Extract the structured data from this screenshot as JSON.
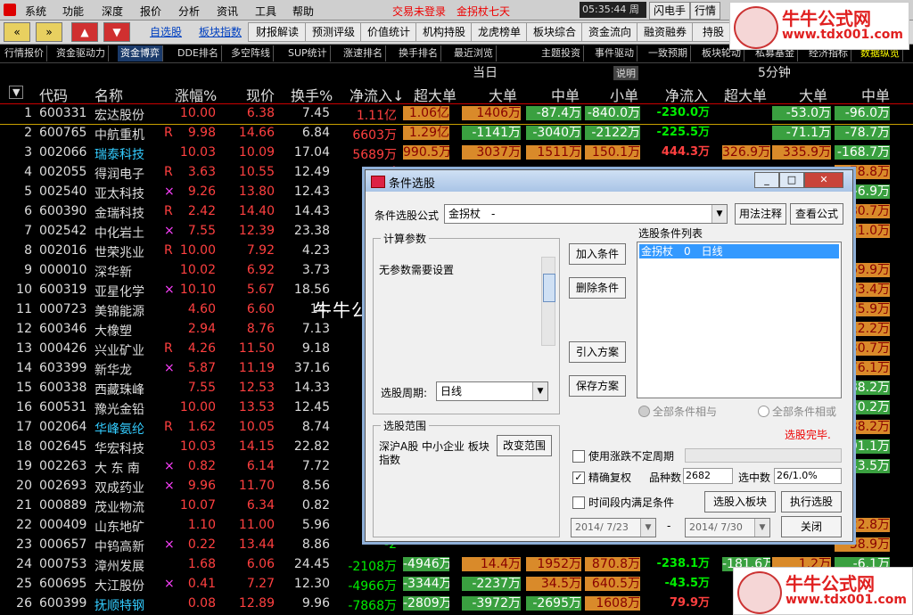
{
  "menu": {
    "items": [
      "系统",
      "功能",
      "深度",
      "报价",
      "分析",
      "资讯",
      "工具",
      "帮助"
    ],
    "status_warning": "交易未登录",
    "formula_title": "金拐杖七天",
    "clock": "05:35:44 周三",
    "right_buttons": [
      "闪电手",
      "行情"
    ]
  },
  "toolbar": {
    "arrows": [
      "«",
      "»",
      "▲",
      "▼"
    ],
    "links": [
      "自选股",
      "板块指数"
    ],
    "buttons": [
      "财报解读",
      "预测评级",
      "价值统计",
      "机构持股",
      "龙虎榜单",
      "板块综合",
      "资金流向",
      "融资融券",
      "持股"
    ]
  },
  "tabs": [
    "行情报价",
    "资金驱动力",
    "资金博弈",
    "DDE排名",
    "多空阵线",
    "SUP统计",
    "涨速排名",
    "换手排名",
    "最近浏览",
    "主题投资",
    "事件驱动",
    "一致预期",
    "板块轮动",
    "私募基金",
    "经济指标",
    "数据纵览"
  ],
  "header_top": {
    "today": "当日",
    "explain": "说明",
    "min5": "5分钟"
  },
  "columns": [
    "代码",
    "名称",
    "涨幅%",
    "现价",
    "换手%",
    "净流入↓",
    "超大单",
    "大单",
    "中单",
    "小单",
    "净流入",
    "超大单",
    "大单",
    "中单"
  ],
  "rows": [
    {
      "no": "1",
      "code": "600331",
      "name": "宏达股份",
      "mark": "",
      "chg": "10.00",
      "price": "6.38",
      "turn": "7.45",
      "net": "1.11亿",
      "b1": "1.06亿",
      "b2": "1406万",
      "b3": "-87.4万",
      "b4": "-840.0万",
      "net5": "-230.0万",
      "c2": "-53.0万",
      "c3": "-96.0万"
    },
    {
      "no": "2",
      "code": "600765",
      "name": "中航重机",
      "mark": "R",
      "chg": "9.98",
      "price": "14.66",
      "turn": "6.84",
      "net": "6603万",
      "b1": "1.29亿",
      "b2": "-1141万",
      "b3": "-3040万",
      "b4": "-2122万",
      "net5": "-225.5万",
      "c2": "-71.1万",
      "c3": "-78.7万"
    },
    {
      "no": "3",
      "code": "002066",
      "name": "瑞泰科技",
      "mark": "",
      "chg": "10.03",
      "price": "10.09",
      "turn": "17.04",
      "net": "5689万",
      "b1": "990.5万",
      "b2": "3037万",
      "b3": "1511万",
      "b4": "150.1万",
      "net5": "444.3万",
      "c1": "326.9万",
      "c2": "335.9万",
      "c3": "-168.7万"
    },
    {
      "no": "4",
      "code": "002055",
      "name": "得润电子",
      "mark": "R",
      "chg": "3.63",
      "price": "10.55",
      "turn": "12.49",
      "net": "4",
      "c3": "78.8万"
    },
    {
      "no": "5",
      "code": "002540",
      "name": "亚太科技",
      "mark": "×",
      "chg": "9.26",
      "price": "13.80",
      "turn": "12.43",
      "net": "4",
      "c3": "-6.9万"
    },
    {
      "no": "6",
      "code": "600390",
      "name": "金瑞科技",
      "mark": "R",
      "chg": "2.42",
      "price": "14.40",
      "turn": "14.43",
      "net": "3",
      "c3": "280.7万"
    },
    {
      "no": "7",
      "code": "002542",
      "name": "中化岩土",
      "mark": "×",
      "chg": "7.55",
      "price": "12.39",
      "turn": "23.38",
      "net": "3",
      "c3": "21.0万"
    },
    {
      "no": "8",
      "code": "002016",
      "name": "世荣兆业",
      "mark": "R",
      "chg": "10.00",
      "price": "7.92",
      "turn": "4.23",
      "net": "2",
      "c3": ""
    },
    {
      "no": "9",
      "code": "000010",
      "name": "深华新",
      "mark": "",
      "chg": "10.02",
      "price": "6.92",
      "turn": "3.73",
      "net": "1",
      "c3": "69.9万"
    },
    {
      "no": "10",
      "code": "600319",
      "name": "亚星化学",
      "mark": "×",
      "chg": "10.10",
      "price": "5.67",
      "turn": "18.56",
      "net": "1",
      "c3": "63.4万"
    },
    {
      "no": "11",
      "code": "000723",
      "name": "美锦能源",
      "mark": "",
      "chg": "4.60",
      "price": "6.60",
      "turn": "14.",
      "net": "",
      "c3": "25.9万"
    },
    {
      "no": "12",
      "code": "600346",
      "name": "大橡塑",
      "mark": "",
      "chg": "2.94",
      "price": "8.76",
      "turn": "7.13",
      "net": "3",
      "c3": "12.2万"
    },
    {
      "no": "13",
      "code": "000426",
      "name": "兴业矿业",
      "mark": "R",
      "chg": "4.26",
      "price": "11.50",
      "turn": "9.18",
      "net": "3",
      "c3": "30.7万"
    },
    {
      "no": "14",
      "code": "603399",
      "name": "新华龙",
      "mark": "×",
      "chg": "5.87",
      "price": "11.19",
      "turn": "37.16",
      "net": "1",
      "c3": "76.1万"
    },
    {
      "no": "15",
      "code": "600338",
      "name": "西藏珠峰",
      "mark": "",
      "chg": "7.55",
      "price": "12.53",
      "turn": "14.33",
      "net": "-1",
      "c3": "-88.2万"
    },
    {
      "no": "16",
      "code": "600531",
      "name": "豫光金铅",
      "mark": "",
      "chg": "10.00",
      "price": "13.53",
      "turn": "12.45",
      "net": "-8",
      "c3": "-20.2万"
    },
    {
      "no": "17",
      "code": "002064",
      "name": "华峰氨纶",
      "mark": "R",
      "chg": "1.62",
      "price": "10.05",
      "turn": "8.74",
      "net": "-1",
      "c3": "88.2万"
    },
    {
      "no": "18",
      "code": "002645",
      "name": "华宏科技",
      "mark": "",
      "chg": "10.03",
      "price": "14.15",
      "turn": "22.82",
      "net": "-1",
      "c3": "-91.1万"
    },
    {
      "no": "19",
      "code": "002263",
      "name": "大 东 南",
      "mark": "×",
      "chg": "0.82",
      "price": "6.14",
      "turn": "7.72",
      "net": "-1",
      "c3": "-43.5万"
    },
    {
      "no": "20",
      "code": "002693",
      "name": "双成药业",
      "mark": "×",
      "chg": "9.96",
      "price": "11.70",
      "turn": "8.56",
      "net": "-1",
      "c3": ""
    },
    {
      "no": "21",
      "code": "000889",
      "name": "茂业物流",
      "mark": "",
      "chg": "10.07",
      "price": "6.34",
      "turn": "0.82",
      "net": "-1",
      "c3": ""
    },
    {
      "no": "22",
      "code": "000409",
      "name": "山东地矿",
      "mark": "",
      "chg": "1.10",
      "price": "11.00",
      "turn": "5.96",
      "net": "-1",
      "c3": "22.8万"
    },
    {
      "no": "23",
      "code": "000657",
      "name": "中钨高新",
      "mark": "×",
      "chg": "0.22",
      "price": "13.44",
      "turn": "8.86",
      "net": "-2",
      "c3": "38.9万"
    },
    {
      "no": "24",
      "code": "000753",
      "name": "漳州发展",
      "mark": "",
      "chg": "1.68",
      "price": "6.06",
      "turn": "24.45",
      "net": "-2108万",
      "b1": "-4946万",
      "b2": "14.4万",
      "b3": "1952万",
      "b4": "870.8万",
      "net5": "-238.1万",
      "c1": "-181.6万",
      "c2": "1.2万",
      "c3": "-6.1万"
    },
    {
      "no": "25",
      "code": "600695",
      "name": "大江股份",
      "mark": "×",
      "chg": "0.41",
      "price": "7.27",
      "turn": "12.30",
      "net": "-4966万",
      "b1": "-3344万",
      "b2": "-2237万",
      "b3": "34.5万",
      "b4": "640.5万",
      "net5": "-43.5万",
      "c1": "",
      "c2": "",
      "c3": ""
    },
    {
      "no": "26",
      "code": "600399",
      "name": "抚顺特钢",
      "mark": "",
      "chg": "0.08",
      "price": "12.89",
      "turn": "9.96",
      "net": "-7868万",
      "b1": "-2809万",
      "b2": "-3972万",
      "b3": "-2695万",
      "b4": "1608万",
      "net5": "79.9万",
      "c1": "",
      "c2": "",
      "c3": ""
    }
  ],
  "watermark": "牛牛公式网  www.tdx001.com",
  "logo": {
    "line1": "牛牛公式网",
    "line2": "www.tdx001.com"
  },
  "dialog": {
    "title": "条件选股",
    "formula_label": "条件选股公式",
    "formula_value": "金拐杖　-",
    "usage_btn": "用法注释",
    "view_btn": "查看公式",
    "calc_group": "计算参数",
    "no_param": "无参数需要设置",
    "list_title": "选股条件列表",
    "list_item": "金拐杖　0　日线",
    "add_btn": "加入条件",
    "del_btn": "删除条件",
    "import_btn": "引入方案",
    "save_btn": "保存方案",
    "period_label": "选股周期:",
    "period_value": "日线",
    "all_and": "全部条件相与",
    "all_or": "全部条件相或",
    "done": "选股完毕.",
    "range_group": "选股范围",
    "range_text": "深沪A股 中小企业 板块指数",
    "change_range": "改变范围",
    "use_unfixed": "使用涨跌不定周期",
    "exact_restore": "精确复权",
    "kinds_label": "品种数",
    "kinds_value": "2682",
    "selected_label": "选中数",
    "selected_value": "26/1.0%",
    "period_match": "时间段内满足条件",
    "to_block": "选股入板块",
    "execute": "执行选股",
    "date_from": "2014/ 7/23",
    "date_to": "2014/ 7/30",
    "close": "关闭",
    "dash": "-"
  },
  "colors": {
    "up": "#ff4040",
    "down": "#00ee00",
    "bar_up": "#d98a2a",
    "bar_down": "#3aa040"
  }
}
